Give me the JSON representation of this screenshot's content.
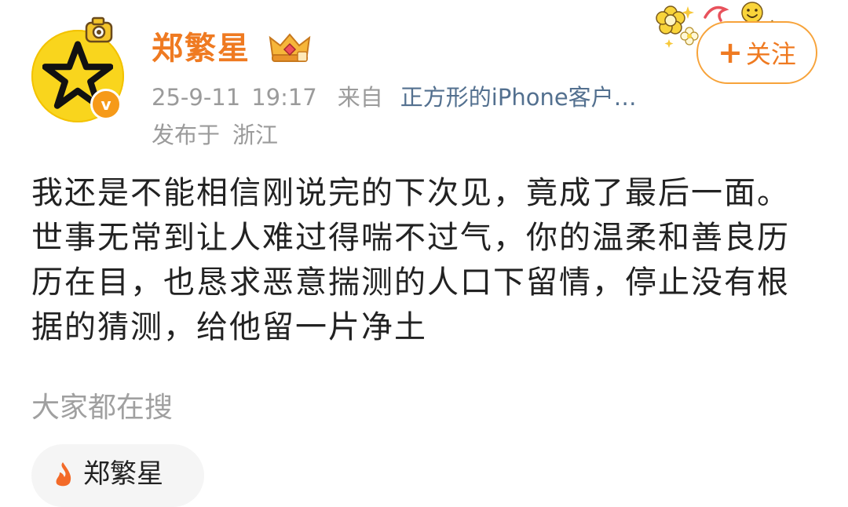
{
  "author": {
    "name": "郑繁星",
    "verified_mark": "v"
  },
  "post_meta": {
    "date": "25-9-11",
    "time": "19:17",
    "from_label": "来自",
    "client": "正方形的iPhone客户…",
    "location_label": "发布于",
    "location": "浙江"
  },
  "follow_button": {
    "plus": "+",
    "label": "关注"
  },
  "post": {
    "text": "我还是不能相信刚说完的下次见，竟成了最后一面。世事无常到让人难过得喘不过气，你的温柔和善良历历在目，也恳求恶意揣测的人口下留情，停止没有根据的猜测，给他留一片净土"
  },
  "search_section": {
    "heading": "大家都在搜",
    "chips": [
      {
        "label": "郑繁星",
        "icon": "hot-icon"
      }
    ]
  },
  "icons": {
    "avatar": "star-icon",
    "camera_decoration": "camera-icon",
    "member_badge": "crown-icon",
    "corner_decoration": "flower-smiley-decoration"
  },
  "colors": {
    "username": "#ef7a21",
    "client_link": "#53708f",
    "meta_text": "#9b9b9b",
    "avatar_bg": "#f9d51d",
    "verified_badge": "#f69a19",
    "follow_border": "#f7a33a",
    "hot_icon": "#f36a28"
  }
}
